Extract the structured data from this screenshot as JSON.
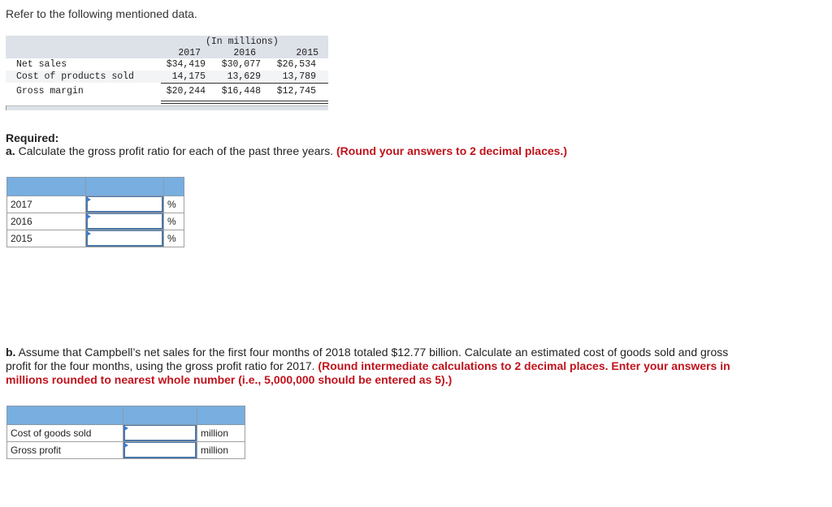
{
  "intro": "Refer to the following mentioned data.",
  "exhibit": {
    "units": "(In millions)",
    "years": [
      "2017",
      "2016",
      "2015"
    ],
    "rows": [
      {
        "label": "Net sales",
        "values": [
          "$34,419",
          "$30,077",
          "$26,534"
        ]
      },
      {
        "label": "Cost of products sold",
        "values": [
          "14,175",
          "13,629",
          "13,789"
        ]
      },
      {
        "label": "Gross margin",
        "values": [
          "$20,244",
          "$16,448",
          "$12,745"
        ]
      }
    ]
  },
  "required_label": "Required:",
  "part_a": {
    "letter": "a.",
    "text": " Calculate the gross profit ratio for each of the past three years. ",
    "instruction": "(Round your answers to 2 decimal places.)",
    "rows": [
      {
        "label": "2017",
        "value": "",
        "unit": "%"
      },
      {
        "label": "2016",
        "value": "",
        "unit": "%"
      },
      {
        "label": "2015",
        "value": "",
        "unit": "%"
      }
    ]
  },
  "part_b": {
    "letter": "b.",
    "text": " Assume that Campbell’s net sales for the first four months of 2018 totaled $12.77 billion. Calculate an estimated cost of goods sold and gross profit for the four months, using the gross profit ratio for 2017. ",
    "instruction": "(Round intermediate calculations to 2 decimal places. Enter your answers in millions rounded to nearest whole number (i.e., 5,000,000 should be entered as 5).)",
    "rows": [
      {
        "label": "Cost of goods sold",
        "value": "",
        "unit": "million"
      },
      {
        "label": "Gross profit",
        "value": "",
        "unit": "million"
      }
    ]
  },
  "colors": {
    "instruction_red": "#c0131c",
    "table_header_blue": "#78aee0",
    "input_border": "#4a78a8",
    "exhibit_gray": "#dde1e8"
  }
}
